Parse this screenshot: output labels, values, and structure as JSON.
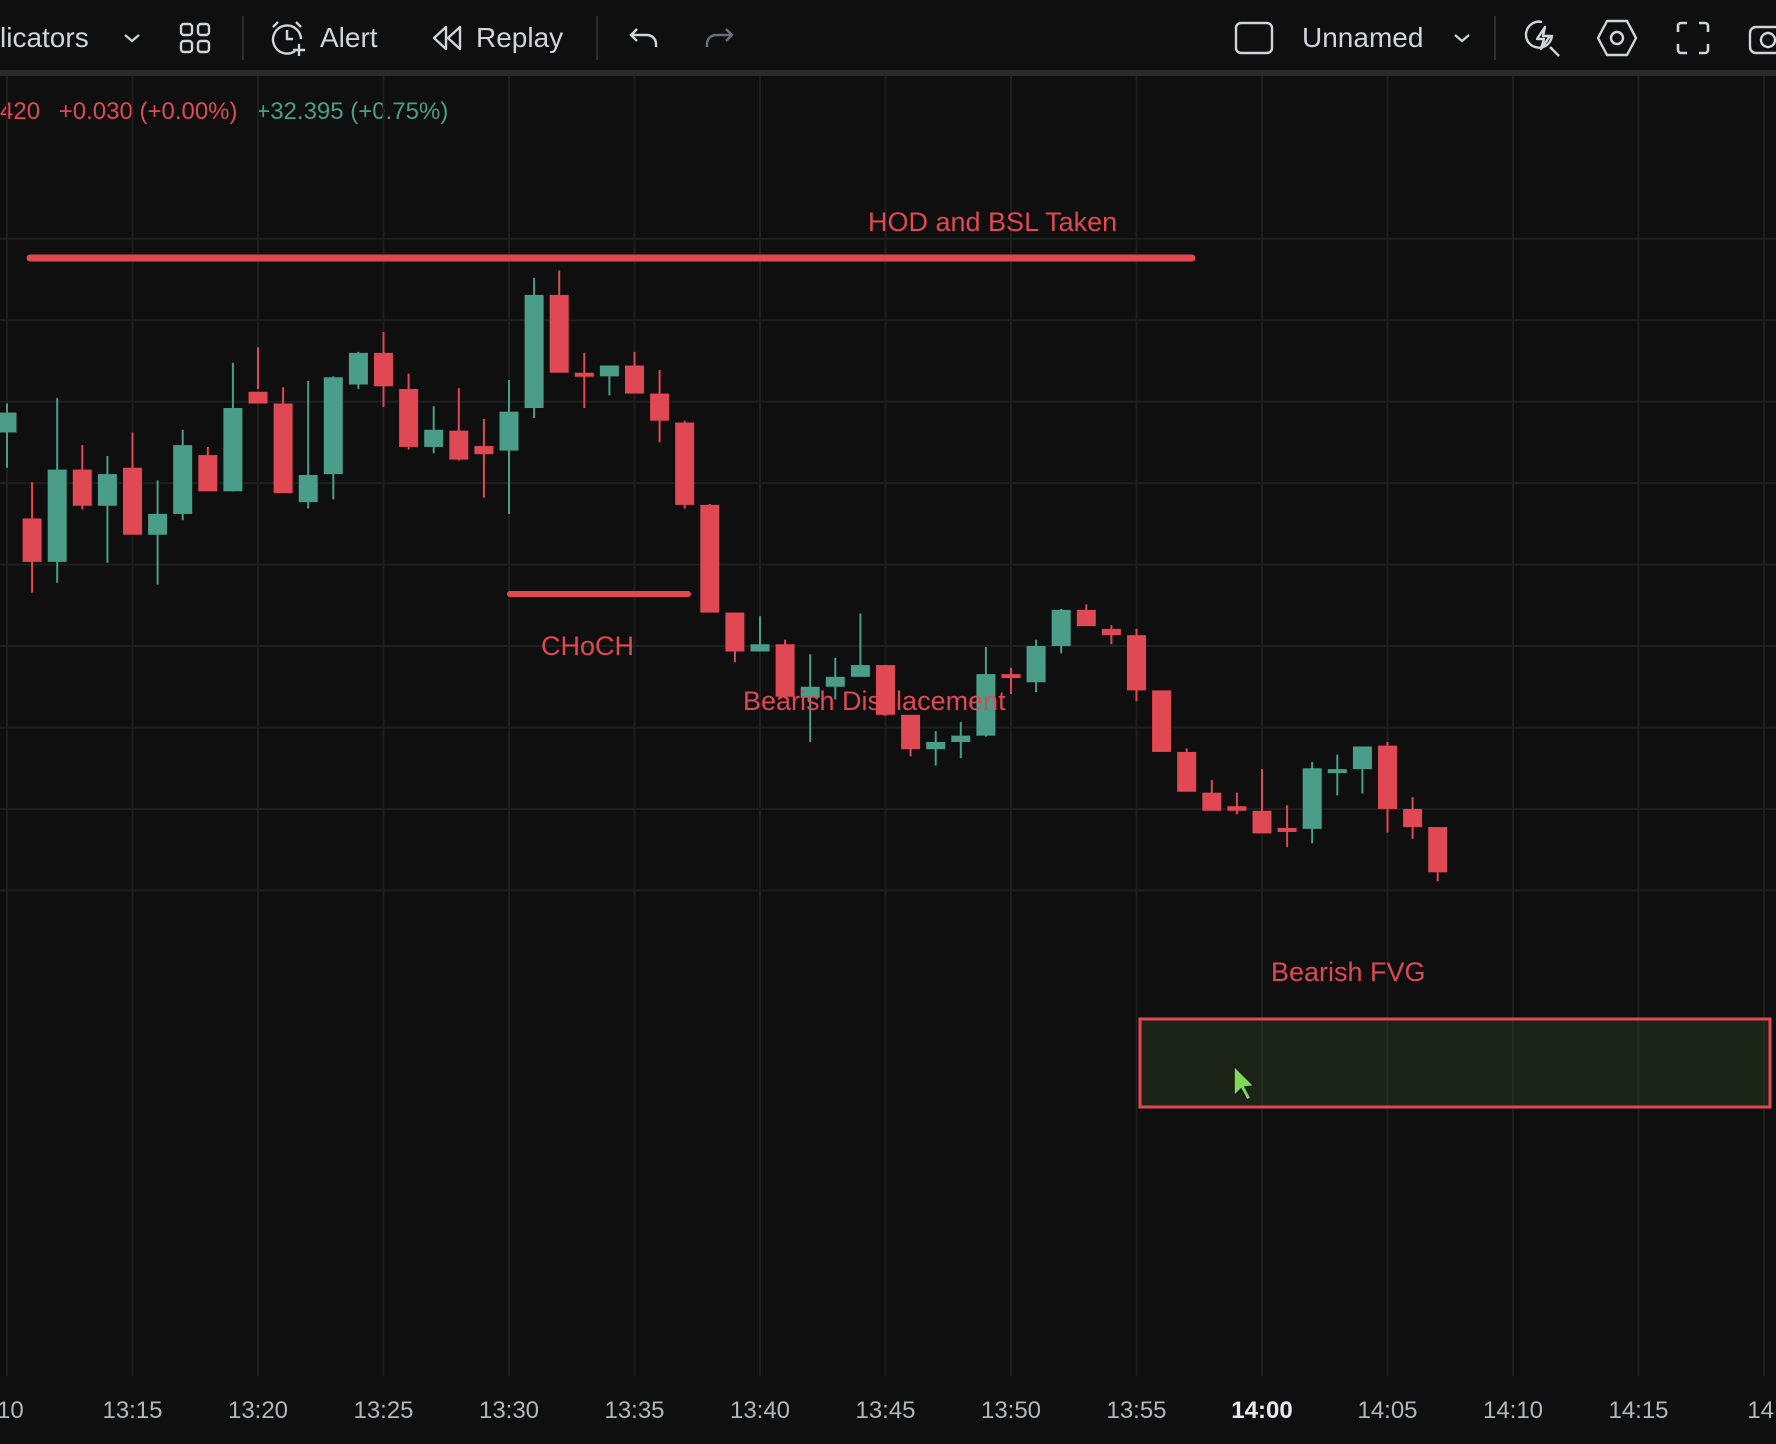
{
  "toolbar": {
    "indicators_label": "licators",
    "alert_label": "Alert",
    "replay_label": "Replay",
    "layout_name": "Unnamed",
    "icons": [
      "chevron-down-icon",
      "templates-grid-icon",
      "alarm-clock-plus-icon",
      "replay-rewind-icon",
      "undo-icon",
      "redo-icon",
      "layout-square-icon",
      "chevron-down-icon",
      "lightning-icon",
      "settings-hexagon-icon",
      "fullscreen-icon",
      "camera-icon"
    ]
  },
  "legend": {
    "price_partial": "420",
    "change": "+0.030 (+0.00%)",
    "change2": "+32.395 (+0.75%)",
    "colors": {
      "down": "#e04854",
      "up": "#4a9e89"
    }
  },
  "annotations": {
    "hod": "HOD and BSL Taken",
    "choch": "CHoCH",
    "displacement": "Bearish Displacement",
    "fvg": "Bearish FVG"
  },
  "chart_data": {
    "type": "candlestick",
    "interval_minutes": 1,
    "x_tick_labels": [
      ":10",
      "13:15",
      "13:20",
      "13:25",
      "13:30",
      "13:35",
      "13:40",
      "13:45",
      "13:50",
      "13:55",
      "14:00",
      "14:05",
      "14:10",
      "14:15",
      "14:"
    ],
    "bold_tick": "14:00",
    "candles": [
      {
        "t": "13:10",
        "o": 22.6,
        "h": 25.8,
        "l": 18.7,
        "c": 24.8
      },
      {
        "t": "13:11",
        "o": 13.1,
        "h": 17.1,
        "l": 4.9,
        "c": 8.3
      },
      {
        "t": "13:12",
        "o": 8.3,
        "h": 26.4,
        "l": 6.0,
        "c": 18.5
      },
      {
        "t": "13:13",
        "o": 18.5,
        "h": 21.2,
        "l": 14.1,
        "c": 14.5
      },
      {
        "t": "13:14",
        "o": 14.5,
        "h": 20.0,
        "l": 8.2,
        "c": 18.0
      },
      {
        "t": "13:15",
        "o": 18.7,
        "h": 22.6,
        "l": 13.4,
        "c": 11.3
      },
      {
        "t": "13:16",
        "o": 11.3,
        "h": 17.3,
        "l": 5.8,
        "c": 13.6
      },
      {
        "t": "13:17",
        "o": 13.6,
        "h": 22.9,
        "l": 12.9,
        "c": 21.2
      },
      {
        "t": "13:18",
        "o": 20.1,
        "h": 21.0,
        "l": 16.3,
        "c": 16.1
      },
      {
        "t": "13:19",
        "o": 16.1,
        "h": 30.3,
        "l": 16.1,
        "c": 25.3
      },
      {
        "t": "13:20",
        "o": 27.1,
        "h": 32.0,
        "l": 27.4,
        "c": 25.8
      },
      {
        "t": "13:21",
        "o": 25.8,
        "h": 27.6,
        "l": 16.4,
        "c": 15.9
      },
      {
        "t": "13:22",
        "o": 14.9,
        "h": 28.3,
        "l": 14.2,
        "c": 17.9
      },
      {
        "t": "13:23",
        "o": 18.0,
        "h": 28.8,
        "l": 15.2,
        "c": 28.7
      },
      {
        "t": "13:24",
        "o": 27.9,
        "h": 31.5,
        "l": 27.4,
        "c": 31.4
      },
      {
        "t": "13:25",
        "o": 31.4,
        "h": 33.7,
        "l": 25.4,
        "c": 27.7
      },
      {
        "t": "13:26",
        "o": 27.4,
        "h": 29.1,
        "l": 20.7,
        "c": 21.0
      },
      {
        "t": "13:27",
        "o": 21.0,
        "h": 25.5,
        "l": 20.3,
        "c": 22.9
      },
      {
        "t": "13:28",
        "o": 22.8,
        "h": 27.5,
        "l": 19.5,
        "c": 19.6
      },
      {
        "t": "13:29",
        "o": 21.1,
        "h": 24.1,
        "l": 15.4,
        "c": 20.2
      },
      {
        "t": "13:30",
        "o": 20.6,
        "h": 28.4,
        "l": 13.6,
        "c": 24.9
      },
      {
        "t": "13:31",
        "o": 25.3,
        "h": 39.7,
        "l": 24.2,
        "c": 37.8
      },
      {
        "t": "13:32",
        "o": 37.8,
        "h": 40.5,
        "l": 30.7,
        "c": 29.2
      },
      {
        "t": "13:33",
        "o": 29.2,
        "h": 31.4,
        "l": 25.3,
        "c": 28.9
      },
      {
        "t": "13:34",
        "o": 28.8,
        "h": 29.3,
        "l": 26.7,
        "c": 30.0
      },
      {
        "t": "13:35",
        "o": 30.0,
        "h": 31.5,
        "l": 27.5,
        "c": 26.9
      },
      {
        "t": "13:36",
        "o": 26.9,
        "h": 29.5,
        "l": 21.5,
        "c": 23.9
      },
      {
        "t": "13:37",
        "o": 23.7,
        "h": 23.9,
        "l": 14.2,
        "c": 14.6
      },
      {
        "t": "13:38",
        "o": 14.6,
        "h": 14.7,
        "l": 4.4,
        "c": 2.7
      },
      {
        "t": "13:39",
        "o": 2.7,
        "h": 2.7,
        "l": -2.8,
        "c": -1.6
      },
      {
        "t": "13:40",
        "o": -1.6,
        "h": 2.3,
        "l": -1.6,
        "c": -0.8
      },
      {
        "t": "13:41",
        "o": -0.8,
        "h": -0.3,
        "l": -6.8,
        "c": -6.6
      },
      {
        "t": "13:42",
        "o": -6.7,
        "h": -1.9,
        "l": -11.6,
        "c": -5.5
      },
      {
        "t": "13:43",
        "o": -5.5,
        "h": -2.3,
        "l": -6.9,
        "c": -4.4
      },
      {
        "t": "13:44",
        "o": -4.4,
        "h": 2.6,
        "l": -4.3,
        "c": -3.1
      },
      {
        "t": "13:45",
        "o": -3.1,
        "h": -3.4,
        "l": -8.7,
        "c": -8.6
      },
      {
        "t": "13:46",
        "o": -8.6,
        "h": -8.8,
        "l": -13.2,
        "c": -12.4
      },
      {
        "t": "13:47",
        "o": -12.4,
        "h": -10.4,
        "l": -14.2,
        "c": -11.6
      },
      {
        "t": "13:48",
        "o": -11.6,
        "h": -9.4,
        "l": -13.4,
        "c": -10.9
      },
      {
        "t": "13:49",
        "o": -10.9,
        "h": -1.1,
        "l": -11.0,
        "c": -4.1
      },
      {
        "t": "13:50",
        "o": -4.1,
        "h": -3.4,
        "l": -6.3,
        "c": -4.4
      },
      {
        "t": "13:51",
        "o": -5.0,
        "h": -0.3,
        "l": -6.1,
        "c": -1.0
      },
      {
        "t": "13:52",
        "o": -1.0,
        "h": 3.1,
        "l": -1.8,
        "c": 3.0
      },
      {
        "t": "13:53",
        "o": 3.0,
        "h": 3.6,
        "l": 1.8,
        "c": 1.2
      },
      {
        "t": "13:54",
        "o": 0.9,
        "h": 1.3,
        "l": -0.8,
        "c": 0.2
      },
      {
        "t": "13:55",
        "o": 0.2,
        "h": 0.9,
        "l": -7.1,
        "c": -5.9
      },
      {
        "t": "13:56",
        "o": -5.9,
        "h": -6.1,
        "l": -12.3,
        "c": -12.7
      },
      {
        "t": "13:57",
        "o": -12.7,
        "h": -12.3,
        "l": -16.7,
        "c": -17.1
      },
      {
        "t": "13:58",
        "o": -17.2,
        "h": -15.8,
        "l": -19.1,
        "c": -19.2
      },
      {
        "t": "13:59",
        "o": -18.7,
        "h": -17.2,
        "l": -19.6,
        "c": -19.2
      },
      {
        "t": "14:00",
        "o": -19.2,
        "h": -14.6,
        "l": -21.5,
        "c": -21.7
      },
      {
        "t": "14:01",
        "o": -21.1,
        "h": -18.6,
        "l": -23.2,
        "c": -21.2
      },
      {
        "t": "14:02",
        "o": -21.2,
        "h": -13.8,
        "l": -22.8,
        "c": -14.5
      },
      {
        "t": "14:03",
        "o": -14.6,
        "h": -13.0,
        "l": -17.5,
        "c": -14.6
      },
      {
        "t": "14:04",
        "o": -14.6,
        "h": -12.1,
        "l": -17.3,
        "c": -12.1
      },
      {
        "t": "14:05",
        "o": -12.0,
        "h": -11.6,
        "l": -21.6,
        "c": -19.0
      },
      {
        "t": "14:06",
        "o": -19.0,
        "h": -17.7,
        "l": -22.3,
        "c": -21.0
      },
      {
        "t": "14:07",
        "o": -21.0,
        "h": -21.3,
        "l": -27.0,
        "c": -26.0
      }
    ]
  }
}
